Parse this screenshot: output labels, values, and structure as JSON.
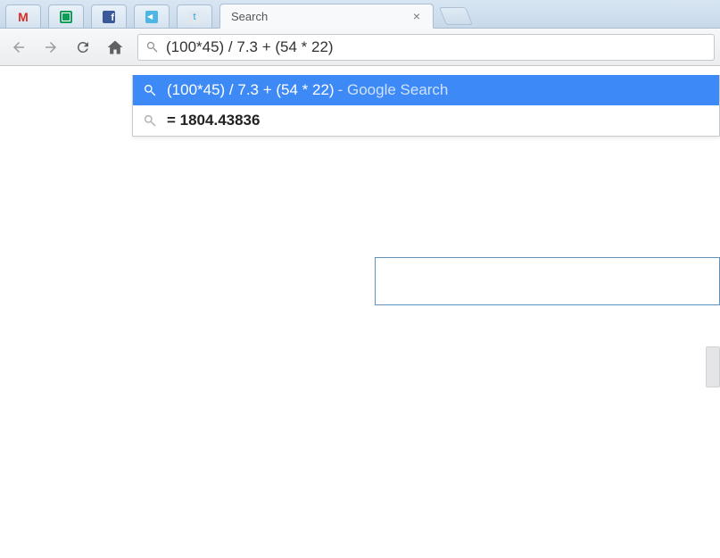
{
  "tabs": {
    "pinned": [
      {
        "name": "gmail",
        "icon": "gmail-icon"
      },
      {
        "name": "sheets",
        "icon": "sheets-icon"
      },
      {
        "name": "facebook",
        "icon": "facebook-icon"
      },
      {
        "name": "sound",
        "icon": "sound-icon"
      },
      {
        "name": "twitter",
        "icon": "twitter-icon"
      }
    ],
    "active": {
      "title": "Search"
    }
  },
  "omnibox": {
    "value": "(100*45) / 7.3 + (54 * 22)"
  },
  "suggestions": {
    "primary": {
      "query": "(100*45) / 7.3 + (54 * 22)",
      "suffix": " - Google Search"
    },
    "result": {
      "text": "= 1804.43836"
    }
  }
}
